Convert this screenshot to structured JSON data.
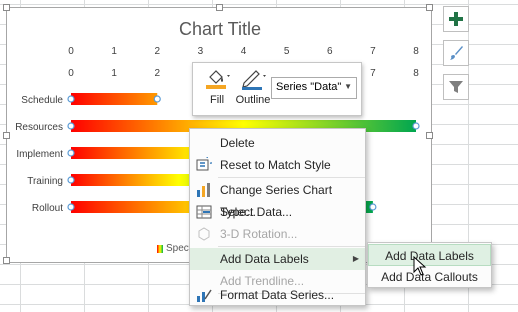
{
  "chart": {
    "title": "Chart Title",
    "legend_text": "Spect",
    "bar_gradient": [
      "#ff0000",
      "#ffff00",
      "#00a650"
    ]
  },
  "chart_data": {
    "type": "bar",
    "orientation": "horizontal",
    "categories": [
      "Schedule",
      "Resources",
      "Implement",
      "Training",
      "Rollout"
    ],
    "values": [
      2,
      8,
      6,
      5,
      7
    ],
    "xlim": [
      0,
      8
    ],
    "xticks": [
      "0",
      "1",
      "2",
      "3",
      "4",
      "5",
      "6",
      "7",
      "8"
    ],
    "title": "Chart Title",
    "grid": false
  },
  "mini_toolbar": {
    "fill_label": "Fill",
    "outline_label": "Outline",
    "series_selected": "Series \"Data\""
  },
  "side_buttons": [
    {
      "icon": "plus-icon"
    },
    {
      "icon": "brush-icon"
    },
    {
      "icon": "filter-icon"
    }
  ],
  "context_menu": {
    "items": [
      {
        "label": "Delete",
        "icon": "",
        "disabled": false
      },
      {
        "label": "Reset to Match Style",
        "icon": "reset-style-icon",
        "disabled": false
      },
      {
        "label": "Change Series Chart Type...",
        "icon": "chart-type-icon",
        "disabled": false
      },
      {
        "label": "Select Data...",
        "icon": "select-data-icon",
        "disabled": false
      },
      {
        "label": "3-D Rotation...",
        "icon": "rotation-icon",
        "disabled": true
      },
      {
        "label": "Add Data Labels",
        "icon": "",
        "disabled": false,
        "highlighted": true,
        "submenu": true
      },
      {
        "label": "Add Trendline...",
        "icon": "",
        "disabled": true
      },
      {
        "label": "Format Data Series...",
        "icon": "format-series-icon",
        "disabled": false
      }
    ]
  },
  "submenu": {
    "items": [
      {
        "label": "Add Data Labels",
        "highlighted": true
      },
      {
        "label": "Add Data Callouts",
        "highlighted": false
      }
    ]
  }
}
